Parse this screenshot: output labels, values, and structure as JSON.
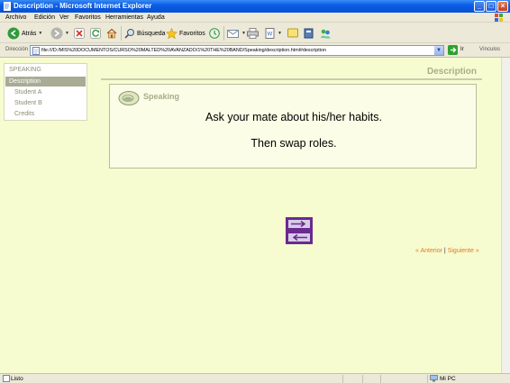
{
  "window": {
    "title": "Description - Microsoft Internet Explorer"
  },
  "menu": [
    "Archivo",
    "Edición",
    "Ver",
    "Favoritos",
    "Herramientas",
    "Ayuda"
  ],
  "toolbar": {
    "back_label": "Atrás",
    "search_label": "Búsqueda",
    "favorites_label": "Favoritos"
  },
  "address": {
    "label": "Dirección",
    "url": "file:///D:/MIS%20DOCUMENTOS/CURSO%20MALTED%20AVANZADO/1%20THE%20BAND/Speaking/description.html#description",
    "go_label": "Ir",
    "links_label": "Vínculos"
  },
  "sidebar": {
    "heading": "SPEAKING",
    "items": [
      "Description",
      "Student A",
      "Student B",
      "Credits"
    ]
  },
  "page": {
    "title": "Description",
    "activity_label": "Speaking",
    "instruction_1": "Ask your mate about his/her habits.",
    "instruction_2": "Then swap roles."
  },
  "pager": {
    "prev": "« Anterior",
    "separator": "|",
    "next": "Siguiente »"
  },
  "status": {
    "text": "Listo",
    "zone": "Mi PC"
  },
  "colors": {
    "content_bg": "#f7fcd0",
    "accent": "#e07a24",
    "arrow": "#6a2a90"
  }
}
